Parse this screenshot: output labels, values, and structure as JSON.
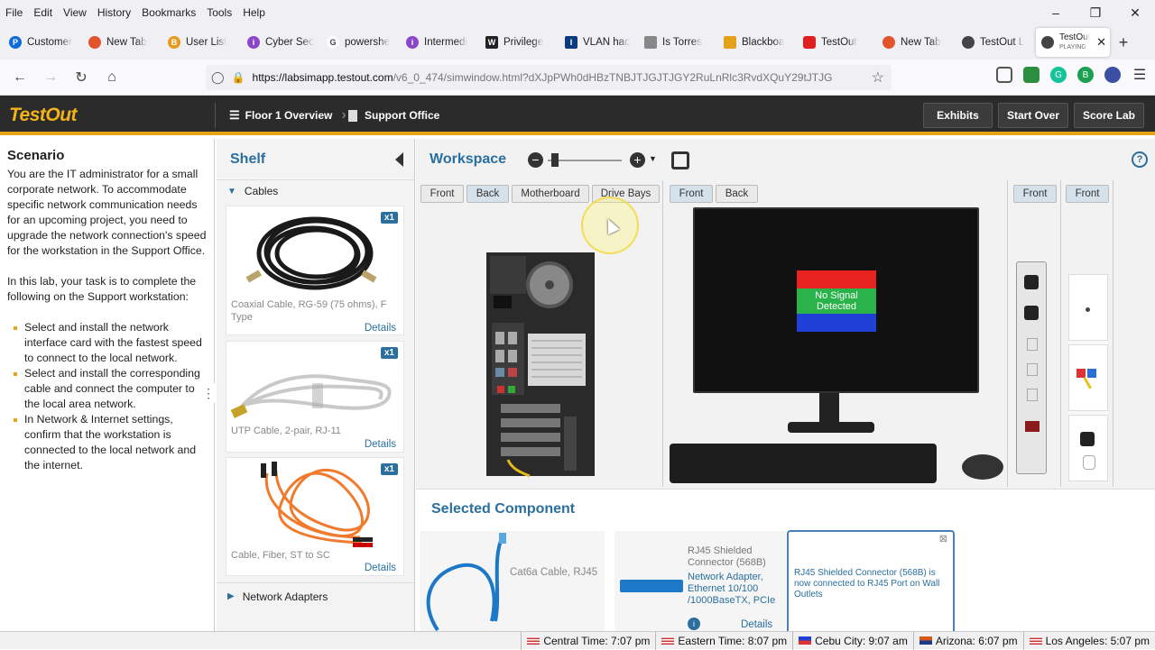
{
  "menubar": {
    "items": [
      "File",
      "Edit",
      "View",
      "History",
      "Bookmarks",
      "Tools",
      "Help"
    ]
  },
  "window_controls": {
    "minimize": "–",
    "maximize": "❐",
    "close": "✕"
  },
  "tabs": [
    {
      "label": "Customer",
      "icon_color": "#0e6bd8",
      "icon": "P"
    },
    {
      "label": "New Tab",
      "icon_color": "#e2542c",
      "icon": ""
    },
    {
      "label": "User List",
      "icon_color": "#e89a1c",
      "icon": "B"
    },
    {
      "label": "Cyber Sec",
      "icon_color": "#8c47c8",
      "icon": "i"
    },
    {
      "label": "powershe",
      "icon_color": "#ffffff",
      "icon": "G"
    },
    {
      "label": "Intermedi",
      "icon_color": "#8c47c8",
      "icon": "i"
    },
    {
      "label": "Privilege",
      "icon_color": "#222222",
      "icon": "W"
    },
    {
      "label": "VLAN hac",
      "icon_color": "#0a3b7a",
      "icon": "I"
    },
    {
      "label": "Is Torres",
      "icon_color": "#888888",
      "icon": ""
    },
    {
      "label": "Blackboa",
      "icon_color": "#e3a21a",
      "icon": ""
    },
    {
      "label": "TestOut",
      "icon_color": "#e02020",
      "icon": ""
    },
    {
      "label": "New Tab",
      "icon_color": "#e2542c",
      "icon": ""
    },
    {
      "label": "TestOut L",
      "icon_color": "#444444",
      "icon": ""
    }
  ],
  "active_tab": {
    "label": "TestOut",
    "sub": "PLAYING",
    "close": "✕"
  },
  "newtab_label": "+",
  "nav": {
    "url_host": "https://labsimapp.testout.com",
    "url_path": "/v6_0_474/simwindow.html?dXJpPWh0dHBzTNBJTJGJTJGY2RuLnRlc3RvdXQuY29tJTJG"
  },
  "app": {
    "logo": "TestOut",
    "crumb1": "Floor 1 Overview",
    "crumb2": "Support Office",
    "exhibits": "Exhibits",
    "start_over": "Start Over",
    "score_lab": "Score Lab"
  },
  "scenario": {
    "title": "Scenario",
    "para1": "You are the IT administrator for a small corporate network. To accommodate specific network communication needs for an upcoming project, you need to upgrade the network connection's speed for the workstation in the Support Office.",
    "para2": "In this lab, your task is to complete the following on the Support workstation:",
    "tasks": [
      "Select and install the network interface card with the fastest speed to connect to the local network.",
      "Select and install the corresponding cable and connect the computer to the local area network.",
      "In Network & Internet settings, confirm that the workstation is connected to the local network and the internet."
    ]
  },
  "shelf": {
    "title": "Shelf",
    "cat_cables": "Cables",
    "cat_adapters": "Network Adapters",
    "items": [
      {
        "name": "Coaxial Cable, RG-59 (75 ohms), F Type",
        "count": "x1",
        "details": "Details"
      },
      {
        "name": "UTP Cable, 2-pair, RJ-11",
        "count": "x1",
        "details": "Details"
      },
      {
        "name": "Cable, Fiber, ST to SC",
        "count": "x1",
        "details": "Details"
      }
    ]
  },
  "workspace": {
    "title": "Workspace",
    "help": "?",
    "views_pc": [
      "Front",
      "Back",
      "Motherboard",
      "Drive Bays"
    ],
    "views_monitor": [
      "Front",
      "Back"
    ],
    "views_power": "Front",
    "views_wall": "Front",
    "monitor_message": "No Signal Detected",
    "colors": {
      "red": "#e8231f",
      "green": "#29b34a",
      "blue": "#1f3fd6"
    }
  },
  "selected": {
    "title": "Selected Component",
    "c1": "Cat6a Cable, RJ45",
    "c2_title": "RJ45 Shielded Connector (568B)",
    "c2_link": "Network Adapter, Ethernet 10/100 /1000BaseTX, PCIe",
    "c2_details": "Details",
    "c3_msg": "RJ45 Shielded Connector (568B) is now connected to RJ45 Port on Wall Outlets"
  },
  "status": [
    {
      "label": "Central Time: 7:07 pm"
    },
    {
      "label": "Eastern Time: 8:07 pm"
    },
    {
      "label": "Cebu City: 9:07 am"
    },
    {
      "label": "Arizona: 6:07 pm"
    },
    {
      "label": "Los Angeles: 5:07 pm"
    }
  ]
}
